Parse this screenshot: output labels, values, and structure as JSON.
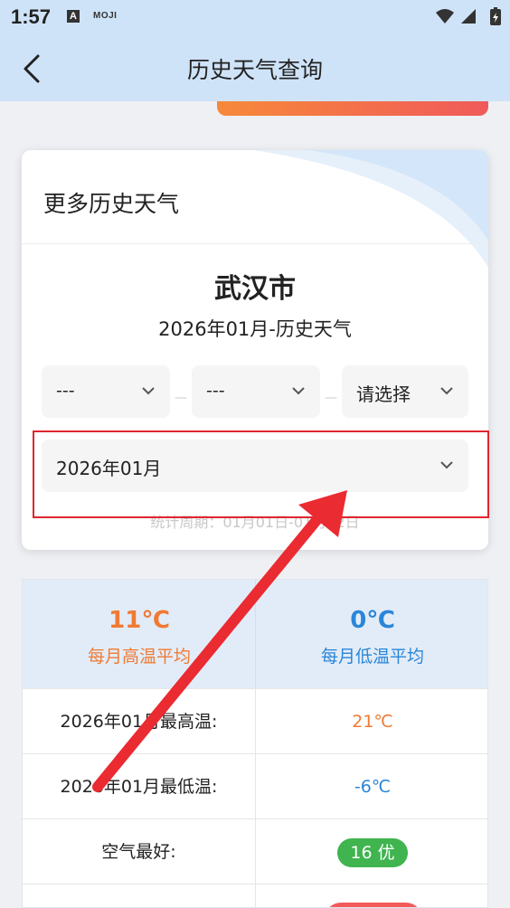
{
  "status": {
    "time": "1:57",
    "a_icon": "A",
    "moji": "MOJI"
  },
  "nav": {
    "title": "历史天气查询"
  },
  "card": {
    "header": "更多历史天气",
    "city": "武汉市",
    "subtitle": "2026年01月-历史天气",
    "selects": [
      {
        "label": "---"
      },
      {
        "label": "---"
      },
      {
        "label": "请选择"
      }
    ],
    "month": "2026年01月",
    "period": "统计周期：01月01日-01月22日"
  },
  "table": {
    "avg_high": {
      "value": "11℃",
      "label": "每月高温平均"
    },
    "avg_low": {
      "value": "0℃",
      "label": "每月低温平均"
    },
    "rows": [
      {
        "label": "2026年01月最高温:",
        "value": "21℃"
      },
      {
        "label": "2026年01月最低温:",
        "value": "-6℃"
      },
      {
        "label": "空气最好:",
        "value": "16 优"
      }
    ]
  },
  "colors": {
    "nav_bg": "#cfe3f8",
    "orange": "#f07a33",
    "blue": "#2a86d8",
    "good_badge": "#3fb44f",
    "highlight": "#e0252e"
  }
}
